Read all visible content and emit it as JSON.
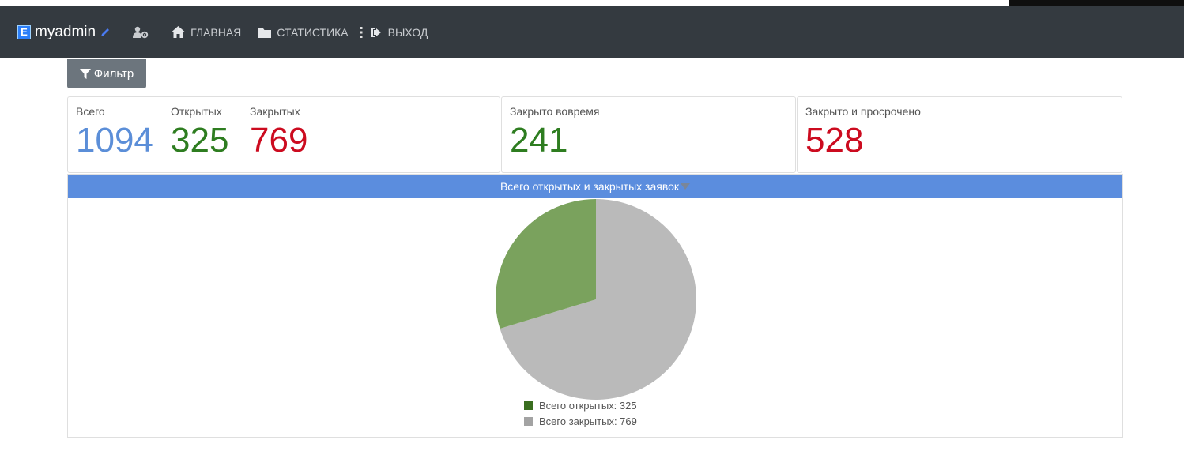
{
  "navbar": {
    "brand_badge": "E",
    "brand_name": "myadmin",
    "items": [
      {
        "label": "ГЛАВНАЯ",
        "icon": "home-icon"
      },
      {
        "label": "СТАТИСТИКА",
        "icon": "folder-icon"
      },
      {
        "label": "ВЫХОД",
        "icon": "sign-out-icon"
      }
    ]
  },
  "filter": {
    "label": "Фильтр"
  },
  "stats": {
    "total_label": "Всего",
    "total_value": "1094",
    "open_label": "Открытых",
    "open_value": "325",
    "closed_label": "Закрытых",
    "closed_value": "769",
    "ontime_label": "Закрыто вовремя",
    "ontime_value": "241",
    "overdue_label": "Закрыто и просрочено",
    "overdue_value": "528"
  },
  "colors": {
    "navbar": "#343a40",
    "accent_blue": "#5b8dde",
    "green": "#2e7d20",
    "red": "#cc0b1f",
    "pie_open": "#7aa25d",
    "pie_closed": "#bababa"
  },
  "chart_data": {
    "type": "pie",
    "title": "Всего открытых и закрытых заявок",
    "categories": [
      "Всего открытых",
      "Всего закрытых"
    ],
    "values": [
      325,
      769
    ],
    "legend": [
      "Всего открытых: 325",
      "Всего закрытых: 769"
    ],
    "legend_colors": [
      "#3a6e20",
      "#a3a3a3"
    ],
    "slice_colors": [
      "#7aa25d",
      "#bababa"
    ],
    "legend_position": "bottom"
  }
}
